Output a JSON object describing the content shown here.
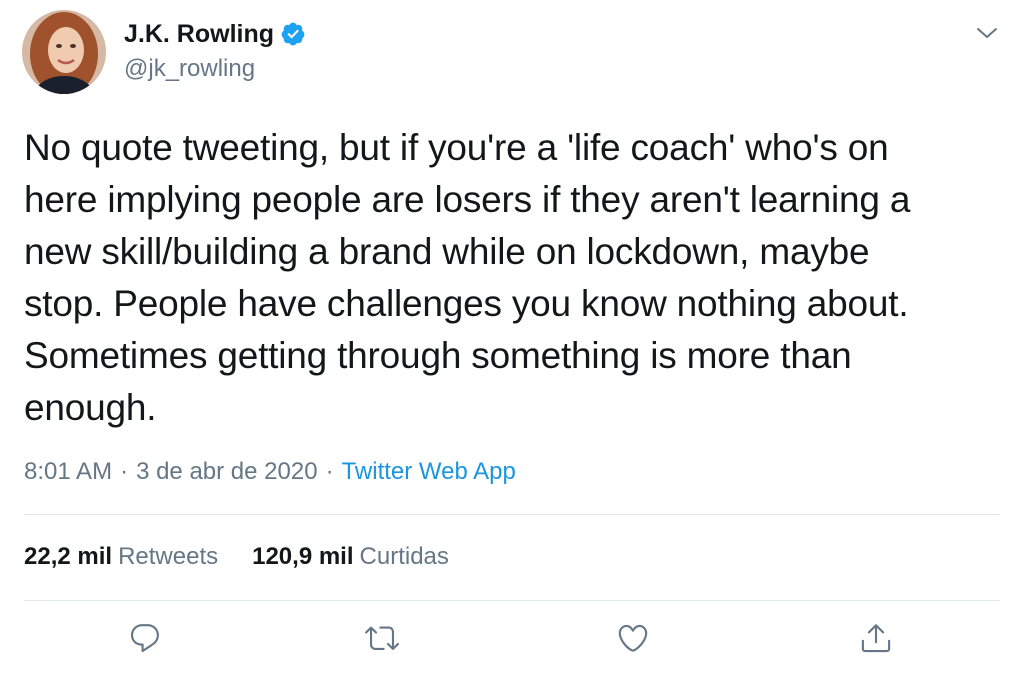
{
  "author": {
    "display_name": "J.K. Rowling",
    "handle": "@jk_rowling",
    "verified": true,
    "verified_color": "#1da1f2"
  },
  "tweet": {
    "text": "No quote tweeting, but if you're a 'life coach' who's on\nhere implying people are losers if they aren't learning a\nnew skill/building a brand while on lockdown, maybe\nstop. People have challenges you know nothing about.\nSometimes getting through something is more than\nenough.",
    "time": "8:01 AM",
    "date": "3 de abr de 2020",
    "separator": "·",
    "source": "Twitter Web App"
  },
  "stats": {
    "retweets_count": "22,2 mil",
    "retweets_label": "Retweets",
    "likes_count": "120,9 mil",
    "likes_label": "Curtidas"
  },
  "actions": {
    "icons": [
      "reply-icon",
      "retweet-icon",
      "like-icon",
      "share-icon"
    ],
    "icon_color": "#657786"
  },
  "menu": {
    "icon": "chevron-down-icon"
  }
}
